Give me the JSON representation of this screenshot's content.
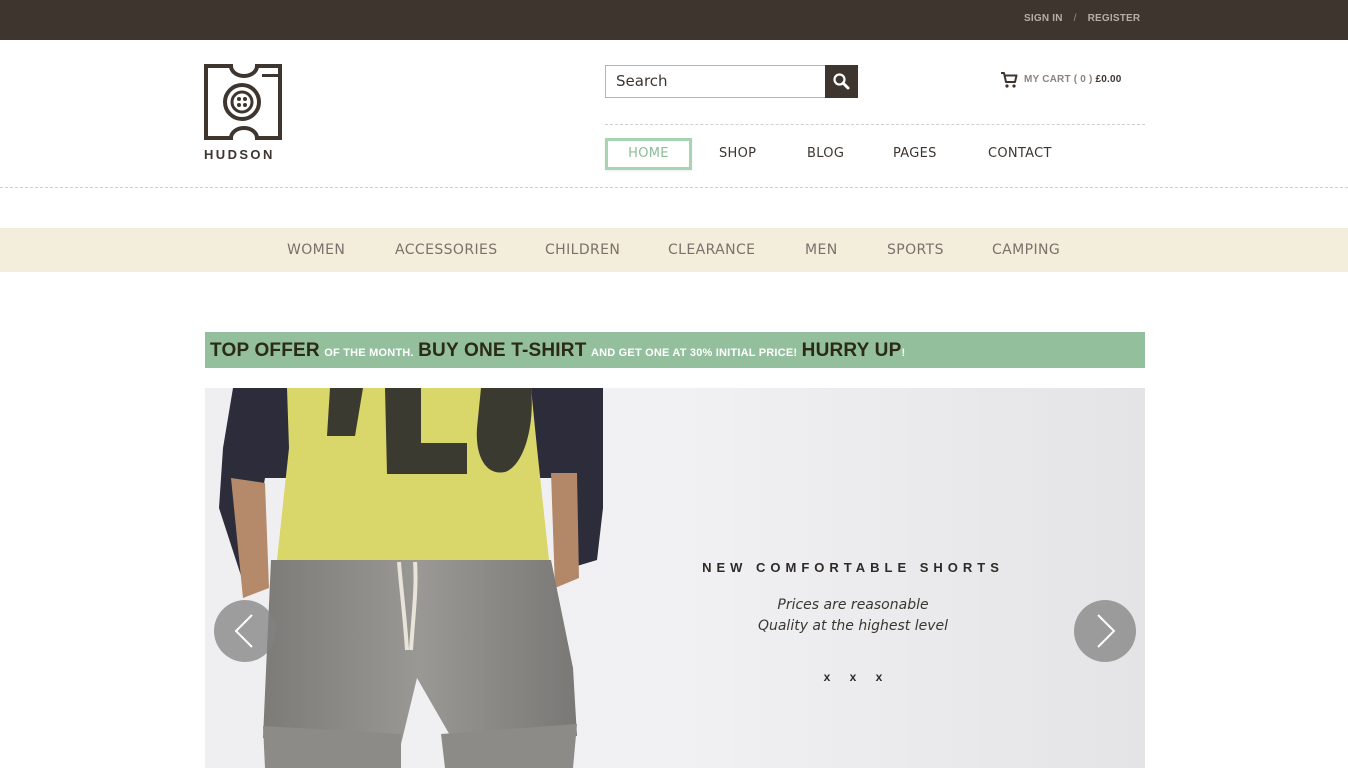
{
  "topbar": {
    "sign_in": "SIGN IN",
    "separator": "/",
    "register": "REGISTER"
  },
  "brand": {
    "name": "HUDSON"
  },
  "search": {
    "value": "Search",
    "icon": "search-icon"
  },
  "cart": {
    "label": "MY CART ( 0 )",
    "total": "£0.00",
    "icon": "cart-icon"
  },
  "nav": {
    "items": [
      {
        "label": "HOME",
        "active": true
      },
      {
        "label": "SHOP"
      },
      {
        "label": "BLOG"
      },
      {
        "label": "PAGES"
      },
      {
        "label": "CONTACT"
      }
    ]
  },
  "categories": [
    "WOMEN",
    "ACCESSORIES",
    "CHILDREN",
    "CLEARANCE",
    "MEN",
    "SPORTS",
    "CAMPING"
  ],
  "offer": {
    "part1": "TOP OFFER",
    "part2": "OF THE MONTH.",
    "part3": "BUY ONE T-SHIRT",
    "part4": "AND GET ONE AT 30% INITIAL PRICE!",
    "part5": "HURRY UP",
    "part6": "!"
  },
  "slider": {
    "title": "NEW COMFORTABLE SHORTS",
    "line1": "Prices are reasonable",
    "line2": "Quality at the highest level",
    "dots": "x x x",
    "prev_icon": "chevron-left-icon",
    "next_icon": "chevron-right-icon"
  },
  "colors": {
    "topbar": "#3e352f",
    "accent_green": "#93bf9c",
    "category_bar": "#f3eedb",
    "home_border": "#a7d5b2"
  }
}
